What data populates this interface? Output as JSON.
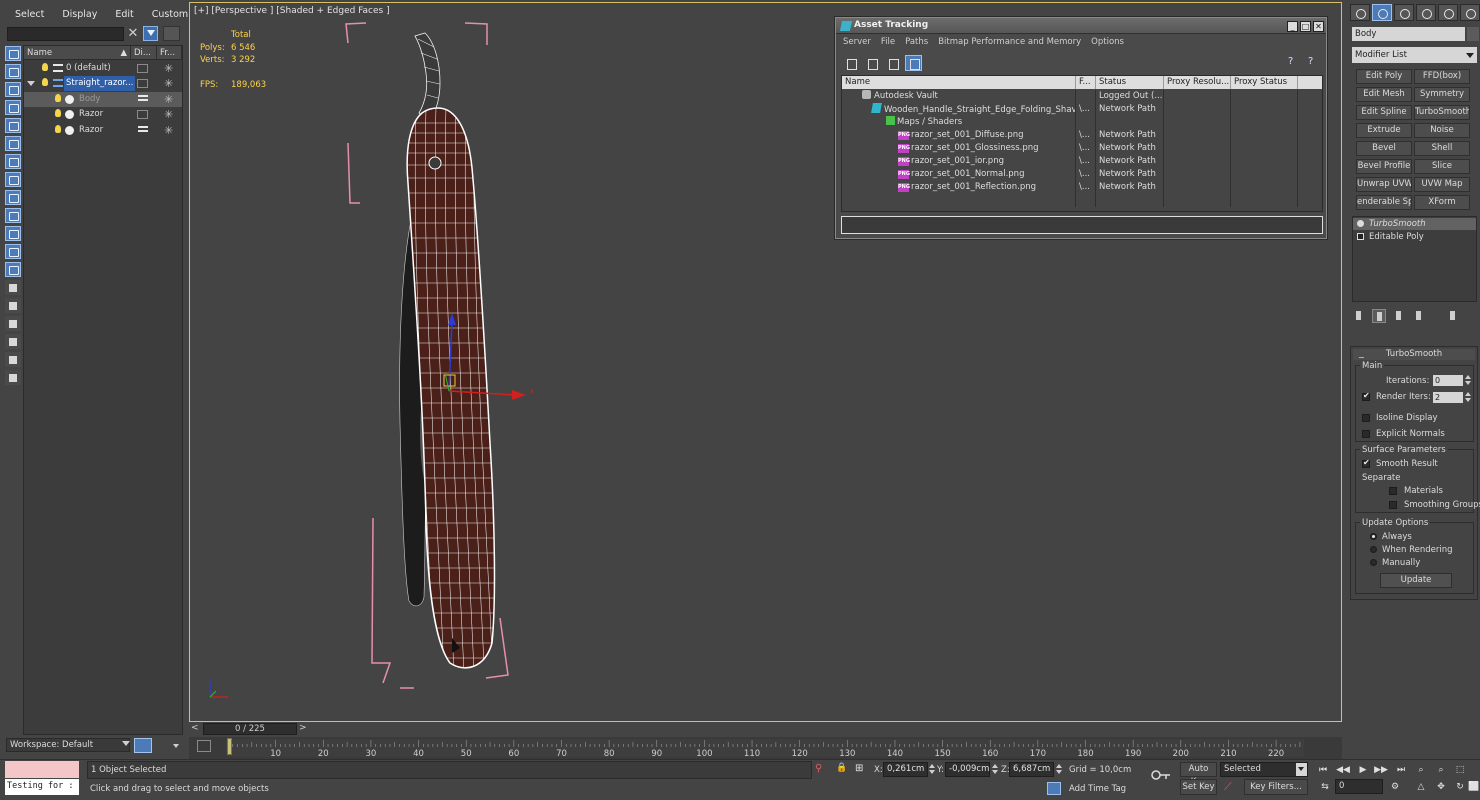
{
  "menu": [
    "Select",
    "Display",
    "Edit",
    "Customize"
  ],
  "explorer": {
    "columns": [
      "Name",
      "Di...",
      "Fr..."
    ],
    "sort_arrow": "▲",
    "rows": [
      {
        "name": "0 (default)",
        "type": "layer"
      },
      {
        "name": "Straight_razor...",
        "type": "layer"
      },
      {
        "name": "Body",
        "type": "object"
      },
      {
        "name": "Razor",
        "type": "object"
      },
      {
        "name": "Razor",
        "type": "object"
      }
    ],
    "workspace": "Workspace: Default"
  },
  "viewport": {
    "label": "[+] [Perspective ] [Shaded + Edged Faces ]",
    "stats_total": "Total",
    "polys_label": "Polys:",
    "polys_value": "6 546",
    "verts_label": "Verts:",
    "verts_value": "3 292",
    "fps_label": "FPS:",
    "fps_value": "189,063",
    "colors": {
      "accent": "#d8c06a",
      "stats": "#ffd24a",
      "wood": "#4a2019",
      "bounds": "#e58fb0"
    }
  },
  "asset_tracking": {
    "title": "Asset Tracking",
    "menu": [
      "Server",
      "File",
      "Paths",
      "Bitmap Performance and Memory",
      "Options"
    ],
    "columns": [
      "Name",
      "F...",
      "Status",
      "Proxy Resolu...",
      "Proxy Status"
    ],
    "rows": [
      {
        "name": "Autodesk Vault",
        "f": "",
        "status": "Logged Out (...",
        "icon": "vault"
      },
      {
        "name": "Wooden_Handle_Straight_Edge_Folding_Shavi...",
        "f": "\\...",
        "status": "Network Path",
        "icon": "max"
      },
      {
        "name": "Maps / Shaders",
        "f": "",
        "status": "",
        "icon": "maps"
      },
      {
        "name": "razor_set_001_Diffuse.png",
        "f": "\\...",
        "status": "Network Path",
        "icon": "png"
      },
      {
        "name": "razor_set_001_Glossiness.png",
        "f": "\\...",
        "status": "Network Path",
        "icon": "png"
      },
      {
        "name": "razor_set_001_ior.png",
        "f": "\\...",
        "status": "Network Path",
        "icon": "png"
      },
      {
        "name": "razor_set_001_Normal.png",
        "f": "\\...",
        "status": "Network Path",
        "icon": "png"
      },
      {
        "name": "razor_set_001_Reflection.png",
        "f": "\\...",
        "status": "Network Path",
        "icon": "png"
      }
    ]
  },
  "command_panel": {
    "object_name": "Body",
    "modifier_list": "Modifier List",
    "modifier_buttons": [
      "Edit Poly",
      "FFD(box)",
      "Edit Mesh",
      "Symmetry",
      "Edit Spline",
      "TurboSmooth",
      "Extrude",
      "Noise",
      "Bevel",
      "Shell",
      "Bevel Profile",
      "Slice",
      "Unwrap UVW",
      "UVW Map",
      "enderable Splin",
      "XForm"
    ],
    "stack": [
      "TurboSmooth",
      "Editable Poly"
    ],
    "rollout": {
      "title": "TurboSmooth",
      "main": "Main",
      "iterations_label": "Iterations:",
      "iterations_value": "0",
      "render_iters_label": "Render Iters:",
      "render_iters_value": "2",
      "isoline": "Isoline Display",
      "explicit": "Explicit Normals",
      "surface": "Surface Parameters",
      "smooth_result": "Smooth Result",
      "separate": "Separate",
      "materials": "Materials",
      "smoothing_groups": "Smoothing Groups",
      "update_options": "Update Options",
      "always": "Always",
      "when_rendering": "When Rendering",
      "manually": "Manually",
      "update": "Update"
    }
  },
  "timeline": {
    "frame_display": "0 / 225",
    "prev": "<",
    "next": ">",
    "ticks": [
      "10",
      "20",
      "30",
      "40",
      "50",
      "60",
      "70",
      "80",
      "90",
      "100",
      "110",
      "120",
      "130",
      "140",
      "150",
      "160",
      "170",
      "180",
      "190",
      "200",
      "210",
      "220"
    ],
    "total_frames": 225
  },
  "status": {
    "maxscript": "Testing for :",
    "selection": "1 Object Selected",
    "prompt": "Click and drag to select and move objects",
    "x_label": "X:",
    "x_value": "0,261cm",
    "y_label": "Y:",
    "y_value": "-0,009cm",
    "z_label": "Z:",
    "z_value": "6,687cm",
    "grid": "Grid = 10,0cm",
    "add_time_tag": "Add Time Tag",
    "auto_key": "Auto Key",
    "selected": "Selected",
    "set_key": "Set Key",
    "key_filters": "Key Filters...",
    "frame": "0"
  }
}
